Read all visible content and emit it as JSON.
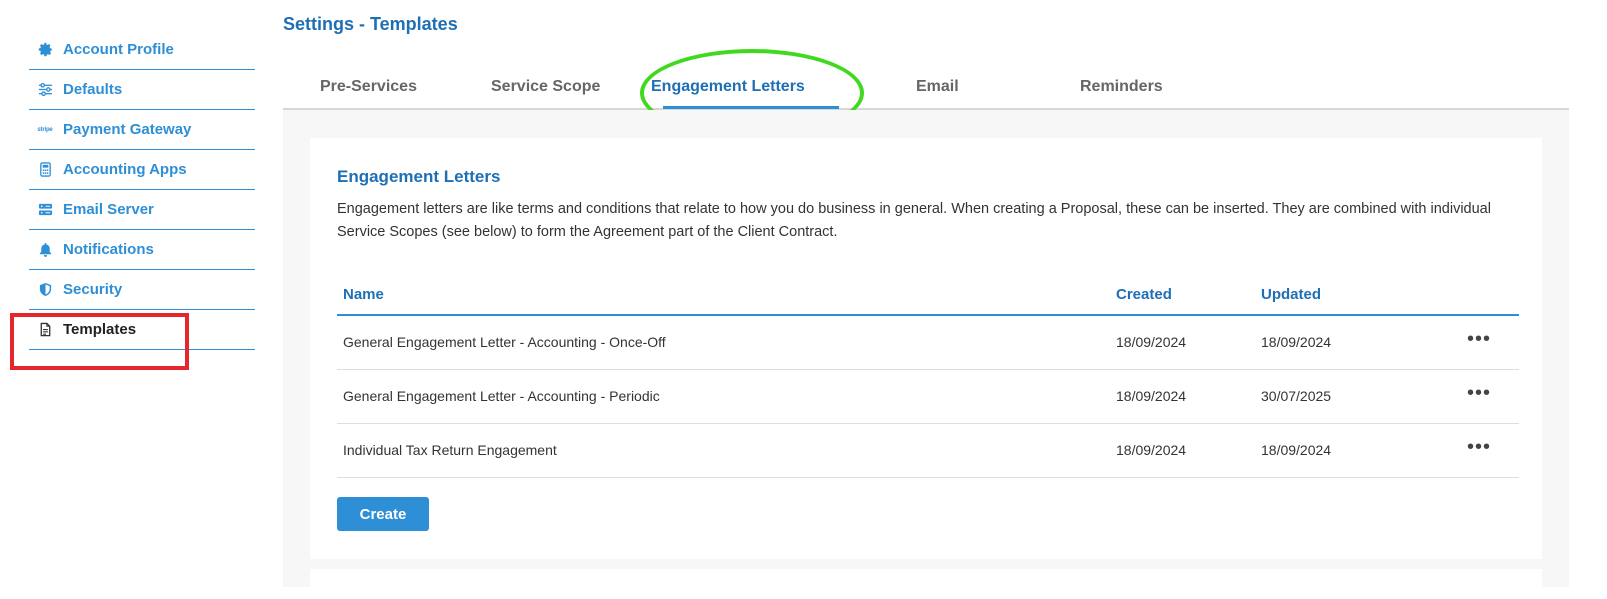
{
  "page": {
    "title": "Settings - Templates"
  },
  "sidebar": {
    "items": [
      {
        "label": "Account Profile",
        "icon": "gear-icon"
      },
      {
        "label": "Defaults",
        "icon": "sliders-icon"
      },
      {
        "label": "Payment Gateway",
        "icon": "stripe-logo-icon",
        "icon_text": "stripe"
      },
      {
        "label": "Accounting Apps",
        "icon": "calculator-icon"
      },
      {
        "label": "Email Server",
        "icon": "server-icon"
      },
      {
        "label": "Notifications",
        "icon": "bell-icon"
      },
      {
        "label": "Security",
        "icon": "shield-icon"
      },
      {
        "label": "Templates",
        "icon": "document-icon",
        "active": true
      }
    ]
  },
  "tabs": [
    {
      "label": "Pre-Services"
    },
    {
      "label": "Service Scope"
    },
    {
      "label": "Engagement Letters",
      "active": true
    },
    {
      "label": "Email"
    },
    {
      "label": "Reminders"
    }
  ],
  "section": {
    "title": "Engagement Letters",
    "description": "Engagement letters are like terms and conditions that relate to how you do business in general. When creating a Proposal, these can be inserted. They are combined with individual Service Scopes (see below) to form the Agreement part of the Client Contract."
  },
  "table": {
    "headers": {
      "name": "Name",
      "created": "Created",
      "updated": "Updated"
    },
    "rows": [
      {
        "name": "General Engagement Letter - Accounting - Once-Off",
        "created": "18/09/2024",
        "updated": "18/09/2024",
        "actions": "•••"
      },
      {
        "name": "General Engagement Letter - Accounting - Periodic",
        "created": "18/09/2024",
        "updated": "30/07/2025",
        "actions": "•••"
      },
      {
        "name": "Individual Tax Return Engagement",
        "created": "18/09/2024",
        "updated": "18/09/2024",
        "actions": "•••"
      }
    ]
  },
  "buttons": {
    "create": "Create"
  },
  "colors": {
    "accent": "#2e8fd6",
    "title": "#1f6fb5",
    "highlight_box": "#e5262b",
    "highlight_ellipse": "#40d91e"
  }
}
